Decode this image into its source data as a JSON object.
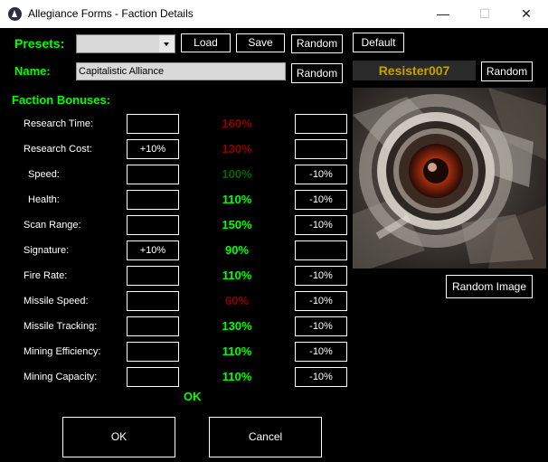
{
  "window": {
    "title": "Allegiance Forms - Faction Details",
    "minimize": "—",
    "maximize": "☐",
    "close": "✕"
  },
  "presets": {
    "label": "Presets:",
    "selected": "",
    "load": "Load",
    "save": "Save",
    "random": "Random",
    "default": "Default"
  },
  "name": {
    "label": "Name:",
    "value": "Capitalistic Alliance",
    "random": "Random"
  },
  "player": {
    "name": "Resister007",
    "random": "Random"
  },
  "faction_bonuses": {
    "heading": "Faction Bonuses:",
    "rows": [
      {
        "label": "Research Time:",
        "left": "",
        "pct": "160%",
        "right": "",
        "color": "#8b0000"
      },
      {
        "label": "Research Cost:",
        "left": "+10%",
        "pct": "130%",
        "right": "",
        "color": "#8b0000"
      },
      {
        "label": "Speed:",
        "left": "",
        "pct": "100%",
        "right": "-10%",
        "color": "#006400"
      },
      {
        "label": "Health:",
        "left": "",
        "pct": "110%",
        "right": "-10%",
        "color": "#00ff00"
      },
      {
        "label": "Scan Range:",
        "left": "",
        "pct": "150%",
        "right": "-10%",
        "color": "#00ff00"
      },
      {
        "label": "Signature:",
        "left": "+10%",
        "pct": "90%",
        "right": "",
        "color": "#00ff00"
      },
      {
        "label": "Fire Rate:",
        "left": "",
        "pct": "110%",
        "right": "-10%",
        "color": "#00ff00"
      },
      {
        "label": "Missile Speed:",
        "left": "",
        "pct": "60%",
        "right": "-10%",
        "color": "#8b0000"
      },
      {
        "label": "Missile Tracking:",
        "left": "",
        "pct": "130%",
        "right": "-10%",
        "color": "#00ff00"
      },
      {
        "label": "Mining Efficiency:",
        "left": "",
        "pct": "110%",
        "right": "-10%",
        "color": "#00ff00"
      },
      {
        "label": "Mining Capacity:",
        "left": "",
        "pct": "110%",
        "right": "-10%",
        "color": "#00ff00"
      }
    ],
    "status": "OK"
  },
  "image": {
    "random_image": "Random Image"
  },
  "footer": {
    "ok": "OK",
    "cancel": "Cancel"
  }
}
